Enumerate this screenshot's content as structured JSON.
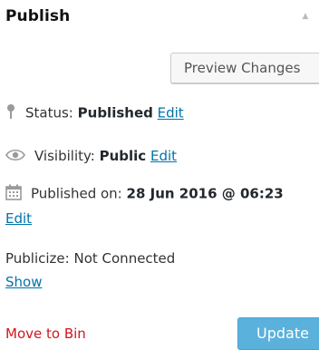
{
  "header": {
    "title": "Publish",
    "toggle_glyph": "▲"
  },
  "actions": {
    "preview_label": "Preview Changes",
    "move_to_bin_label": "Move to Bin",
    "update_label": "Update"
  },
  "status": {
    "icon": "pin-icon",
    "label": "Status:",
    "value": "Published",
    "edit_label": "Edit"
  },
  "visibility": {
    "icon": "eye-icon",
    "label": "Visibility:",
    "value": "Public",
    "edit_label": "Edit"
  },
  "published_on": {
    "icon": "calendar-icon",
    "label": "Published on:",
    "value": "28 Jun 2016 @ 06:23",
    "edit_label": "Edit"
  },
  "publicize": {
    "text": "Publicize: Not Connected",
    "show_label": "Show"
  },
  "colors": {
    "link": "#0073aa",
    "danger": "#d3151b",
    "primary_button": "#5ab1dc"
  }
}
